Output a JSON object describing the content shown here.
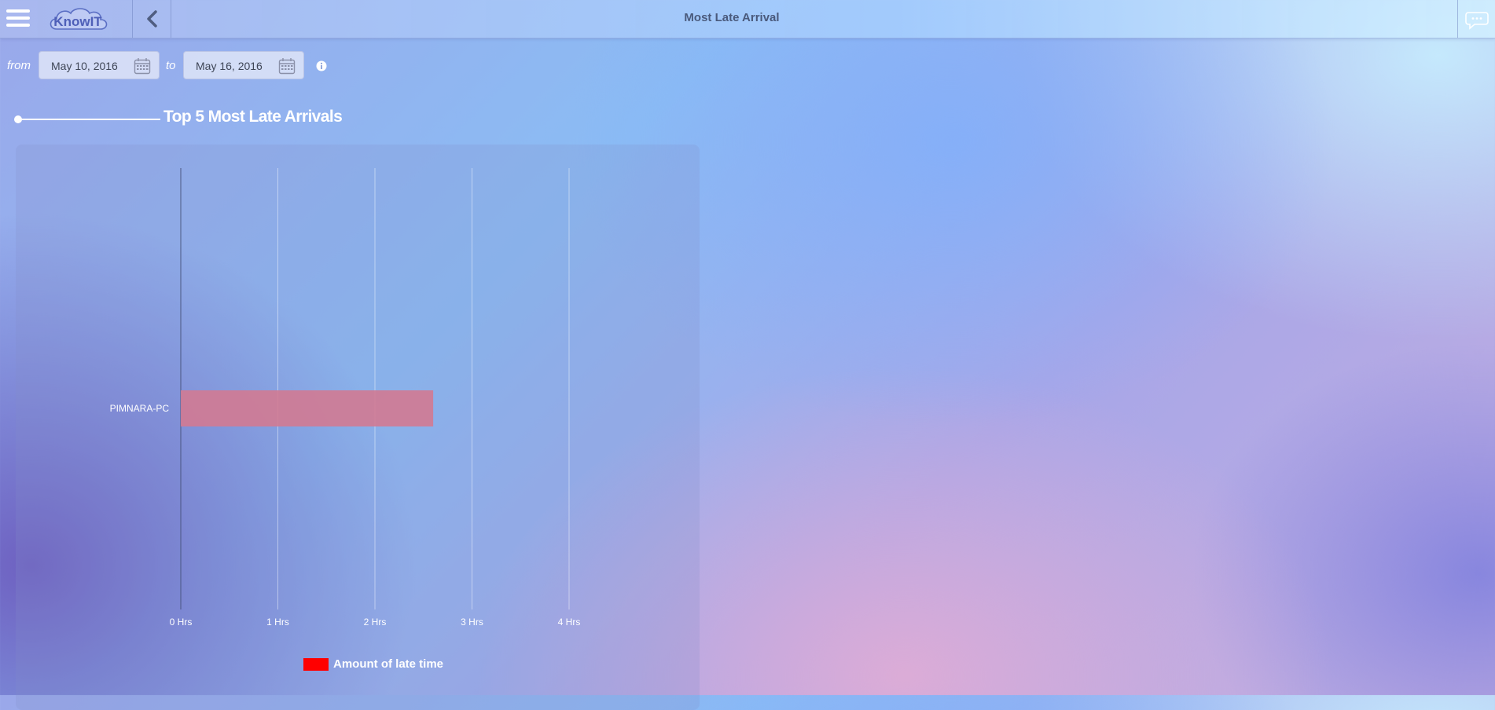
{
  "header": {
    "title": "Most Late Arrival",
    "logo_text": "KnowIT"
  },
  "filters": {
    "from_label": "from",
    "to_label": "to",
    "from_date": "May 10, 2016",
    "to_date": "May 16, 2016"
  },
  "section": {
    "title": "Top 5 Most Late Arrivals"
  },
  "colors": {
    "bar": "#d27a92",
    "legend": "#ff0000"
  },
  "chart_data": {
    "type": "bar",
    "orientation": "horizontal",
    "title": "Top 5 Most Late Arrivals",
    "categories": [
      "PIMNARA-PC"
    ],
    "series": [
      {
        "name": "Amount of late time",
        "values": [
          2.6
        ]
      }
    ],
    "x_ticks": [
      "0 Hrs",
      "1 Hrs",
      "2 Hrs",
      "3 Hrs",
      "4 Hrs"
    ],
    "xlim": [
      0,
      4
    ],
    "grid": true,
    "legend_position": "bottom"
  }
}
